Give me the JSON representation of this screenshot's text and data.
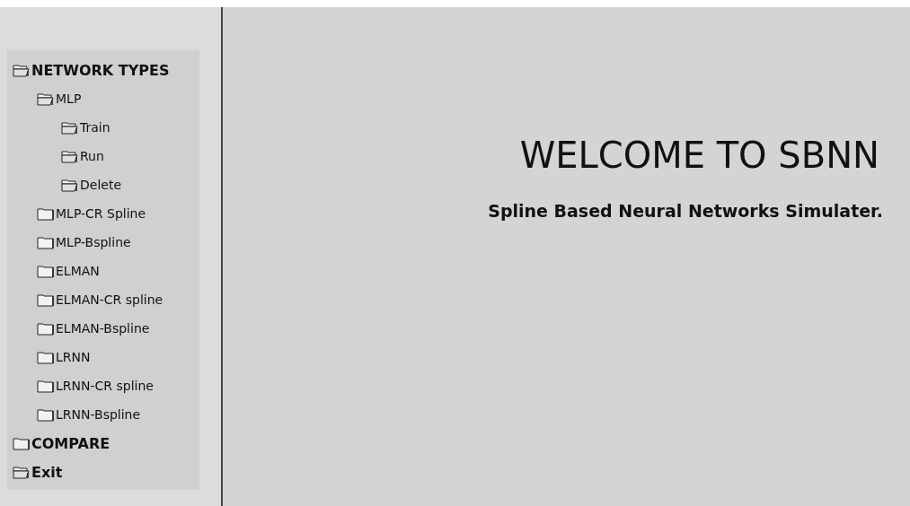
{
  "tree": [
    {
      "label": "NETWORK TYPES",
      "open": true,
      "children": [
        {
          "label": "MLP",
          "open": true,
          "children": [
            {
              "label": "Train",
              "open": true
            },
            {
              "label": "Run",
              "open": true
            },
            {
              "label": "Delete",
              "open": true
            }
          ]
        },
        {
          "label": "MLP-CR Spline",
          "open": false
        },
        {
          "label": "MLP-Bspline",
          "open": false
        },
        {
          "label": "ELMAN",
          "open": false
        },
        {
          "label": "ELMAN-CR spline",
          "open": false
        },
        {
          "label": "ELMAN-Bspline",
          "open": false
        },
        {
          "label": "LRNN",
          "open": false
        },
        {
          "label": "LRNN-CR spline",
          "open": false
        },
        {
          "label": "LRNN-Bspline",
          "open": false
        }
      ]
    },
    {
      "label": "COMPARE",
      "open": false
    },
    {
      "label": "Exit",
      "open": true
    }
  ],
  "main": {
    "title": "WELCOME TO SBNN",
    "subtitle": "Spline Based Neural Networks Simulater."
  }
}
